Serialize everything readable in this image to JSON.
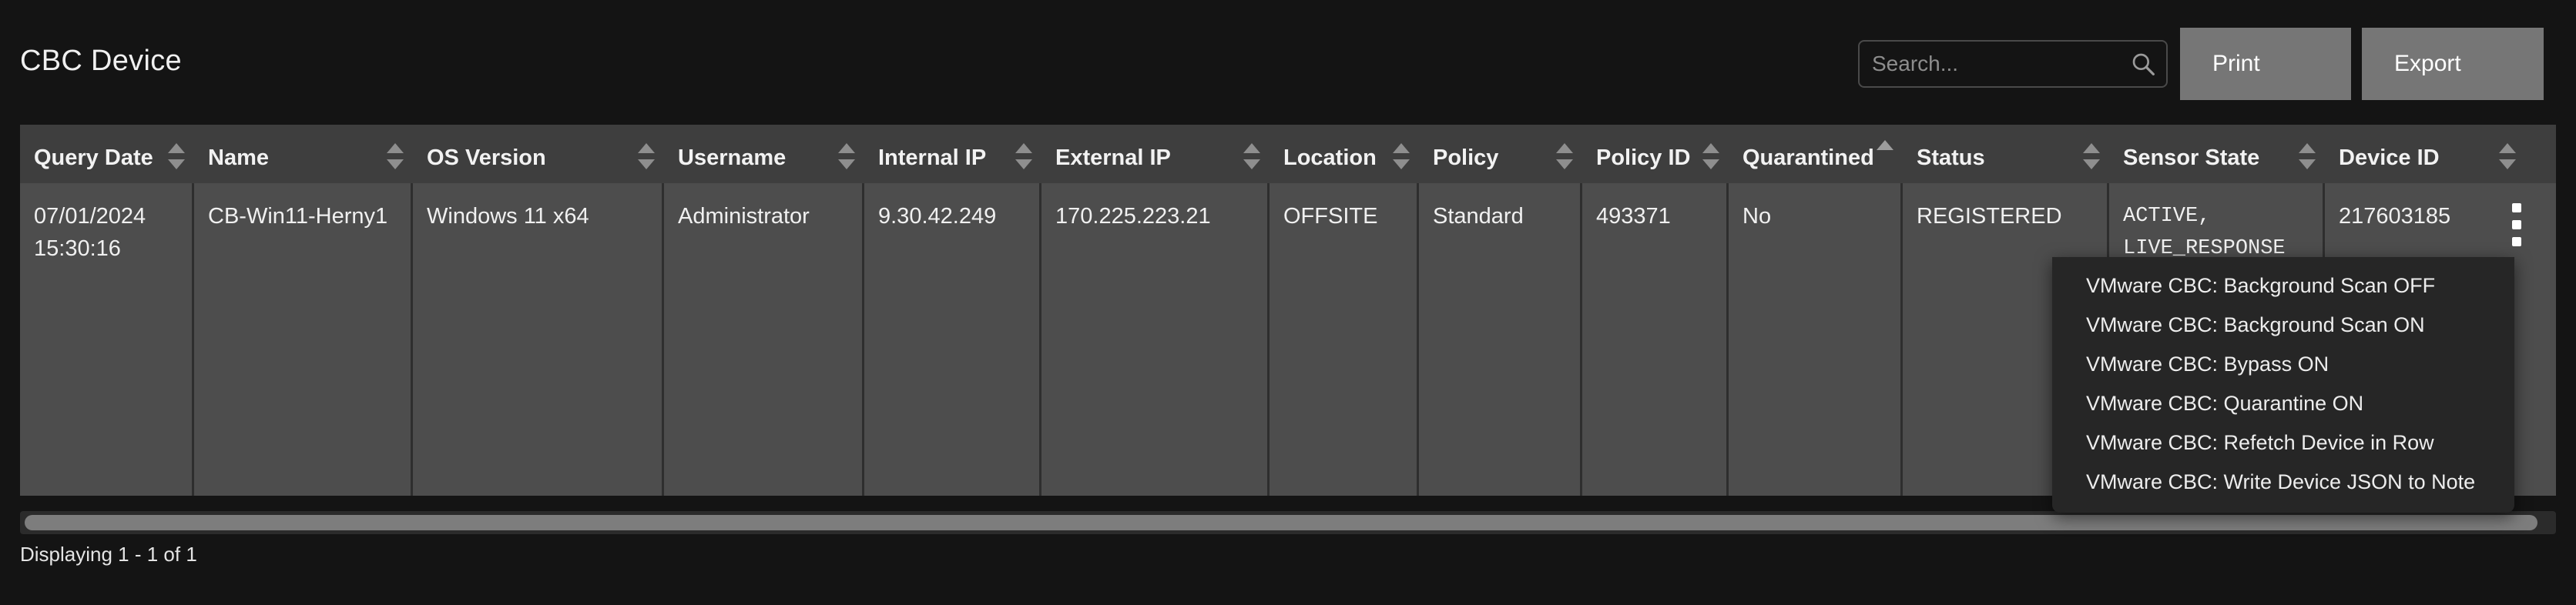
{
  "header": {
    "title": "CBC Device",
    "search": {
      "placeholder": "Search...",
      "value": "",
      "icon": "search-icon"
    },
    "buttons": [
      {
        "label": "Print"
      },
      {
        "label": "Export"
      }
    ]
  },
  "table": {
    "columns": [
      {
        "label": "Query Date",
        "sort": "both"
      },
      {
        "label": "Name",
        "sort": "both"
      },
      {
        "label": "OS Version",
        "sort": "both"
      },
      {
        "label": "Username",
        "sort": "both"
      },
      {
        "label": "Internal IP",
        "sort": "both"
      },
      {
        "label": "External IP",
        "sort": "both"
      },
      {
        "label": "Location",
        "sort": "both"
      },
      {
        "label": "Policy",
        "sort": "both"
      },
      {
        "label": "Policy ID",
        "sort": "both"
      },
      {
        "label": "Quarantined",
        "sort": "asc"
      },
      {
        "label": "Status",
        "sort": "both"
      },
      {
        "label": "Sensor State",
        "sort": "both"
      },
      {
        "label": "Device ID",
        "sort": "both"
      }
    ],
    "rows": [
      {
        "query_date": "07/01/2024 15:30:16",
        "name": "CB-Win11-Herny1",
        "os_version": "Windows 11 x64",
        "username": "Administrator",
        "internal_ip": "9.30.42.249",
        "external_ip": "170.225.223.21",
        "location": "OFFSITE",
        "policy": "Standard",
        "policy_id": "493371",
        "quarantined": "No",
        "status": "REGISTERED",
        "sensor_state": "ACTIVE, LIVE_RESPONSE",
        "device_id": "217603185"
      }
    ],
    "row_menu_icon": "kebab-menu-icon"
  },
  "context_menu": {
    "items": [
      {
        "label": "VMware CBC: Background Scan OFF"
      },
      {
        "label": "VMware CBC: Background Scan ON"
      },
      {
        "label": "VMware CBC: Bypass ON"
      },
      {
        "label": "VMware CBC: Quarantine ON"
      },
      {
        "label": "VMware CBC: Refetch Device in Row"
      },
      {
        "label": "VMware CBC: Write Device JSON to Note"
      }
    ]
  },
  "footer": {
    "status_text": "Displaying 1 - 1 of 1"
  },
  "colors": {
    "page_background": "#141414",
    "header_row": "#3e3e3e",
    "cell_background": "#4d4d4d",
    "button": "#767676",
    "menu_background": "#262626",
    "text": "#f0f0f0"
  }
}
